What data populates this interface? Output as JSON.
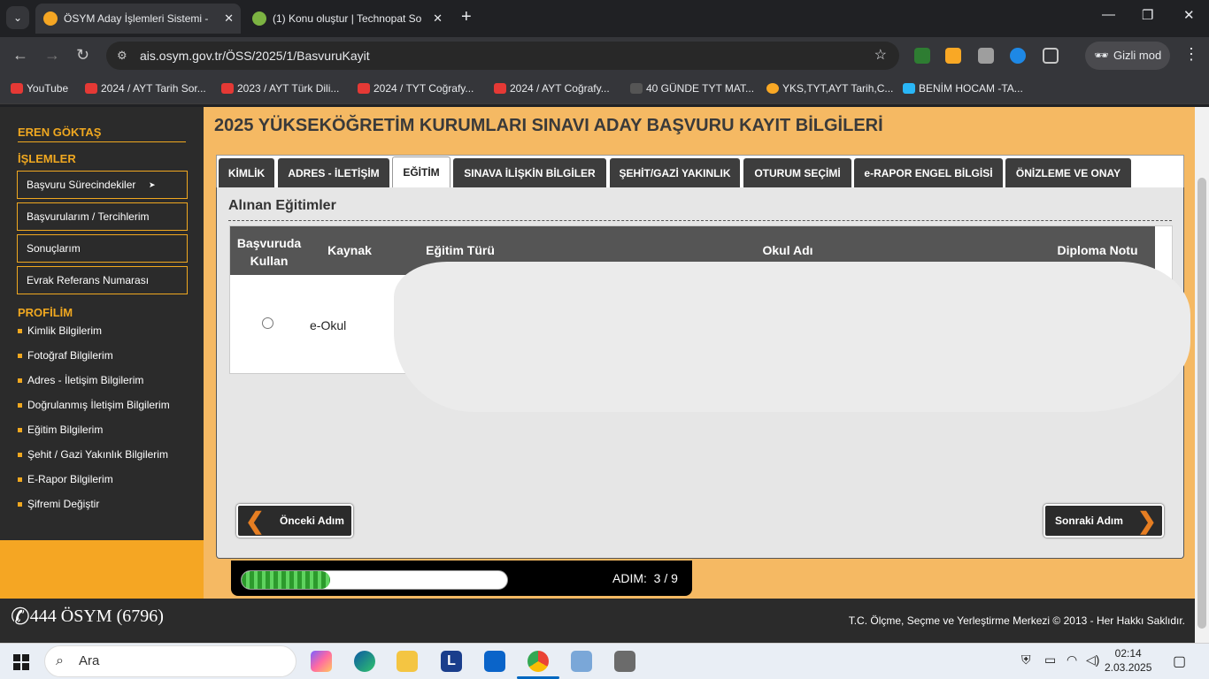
{
  "browser": {
    "tabs": [
      {
        "title": "ÖSYM Aday İşlemleri Sistemi - ",
        "active": true
      },
      {
        "title": "(1) Konu oluştur | Technopat So",
        "active": false
      }
    ],
    "close_glyph": "✕",
    "new_tab": "+",
    "url": "ais.osym.gov.tr/ÖSS/2025/1/BasvuruKayit",
    "incognito_label": "Gizli mod",
    "bookmarks": [
      {
        "label": "YouTube",
        "icon": "youtube-icon"
      },
      {
        "label": "2024 / AYT Tarih Sor...",
        "icon": "youtube-icon"
      },
      {
        "label": "2023 / AYT Türk Dili...",
        "icon": "youtube-icon"
      },
      {
        "label": "2024 / TYT Coğrafy...",
        "icon": "youtube-icon"
      },
      {
        "label": "2024 / AYT Coğrafy...",
        "icon": "youtube-icon"
      },
      {
        "label": "40 GÜNDE TYT MAT...",
        "icon": "site-icon"
      },
      {
        "label": "YKS,TYT,AYT Tarih,C...",
        "icon": "site-icon"
      },
      {
        "label": "BENİM HOCAM -TA...",
        "icon": "graduation-icon"
      }
    ]
  },
  "sidebar": {
    "user": "EREN GÖKTAŞ",
    "islemler_title": "İŞLEMLER",
    "islemler": [
      "Başvuru Sürecindekiler",
      "Başvurularım / Tercihlerim",
      "Sonuçlarım",
      "Evrak Referans Numarası"
    ],
    "profil_title": "PROFİLİM",
    "profil": [
      "Kimlik Bilgilerim",
      "Fotoğraf Bilgilerim",
      "Adres - İletişim Bilgilerim",
      "Doğrulanmış İletişim Bilgilerim",
      "Eğitim Bilgilerim",
      "Şehit / Gazi Yakınlık Bilgilerim",
      "E-Rapor Bilgilerim",
      "Şifremi Değiştir"
    ]
  },
  "main": {
    "title": "2025 YÜKSEKÖĞRETİM KURUMLARI SINAVI ADAY BAŞVURU KAYIT BİLGİLERİ",
    "tabs": [
      {
        "label": "KİMLİK",
        "active": false
      },
      {
        "label": "ADRES - İLETİŞİM",
        "active": false
      },
      {
        "label": "EĞİTİM",
        "active": true
      },
      {
        "label": "SINAVA İLİŞKİN BİLGİLER",
        "active": false
      },
      {
        "label": "ŞEHİT/GAZİ YAKINLIK",
        "active": false
      },
      {
        "label": "OTURUM SEÇİMİ",
        "active": false
      },
      {
        "label": "e-RAPOR ENGEL BİLGİSİ",
        "active": false
      },
      {
        "label": "ÖNİZLEME VE ONAY",
        "active": false
      }
    ],
    "section_title": "Alınan Eğitimler",
    "table": {
      "headers": [
        "Başvuruda Kullan",
        "Kaynak",
        "Eğitim Türü",
        "Okul Adı",
        "Diploma Notu"
      ],
      "rows": [
        {
          "source": "e-Okul"
        }
      ]
    },
    "prev_label": "Önceki Adım",
    "next_label": "Sonraki Adım",
    "progress": {
      "label": "ADIM:",
      "value": "3 / 9",
      "fraction": 0.333
    }
  },
  "footer": {
    "phone": "444 ÖSYM (6796)",
    "copyright": "T.C. Ölçme, Seçme ve Yerleştirme Merkezi © 2013 - Her Hakkı Saklıdır."
  },
  "taskbar": {
    "search_placeholder": "Ara",
    "time": "02:14",
    "date": "2.03.2025"
  }
}
